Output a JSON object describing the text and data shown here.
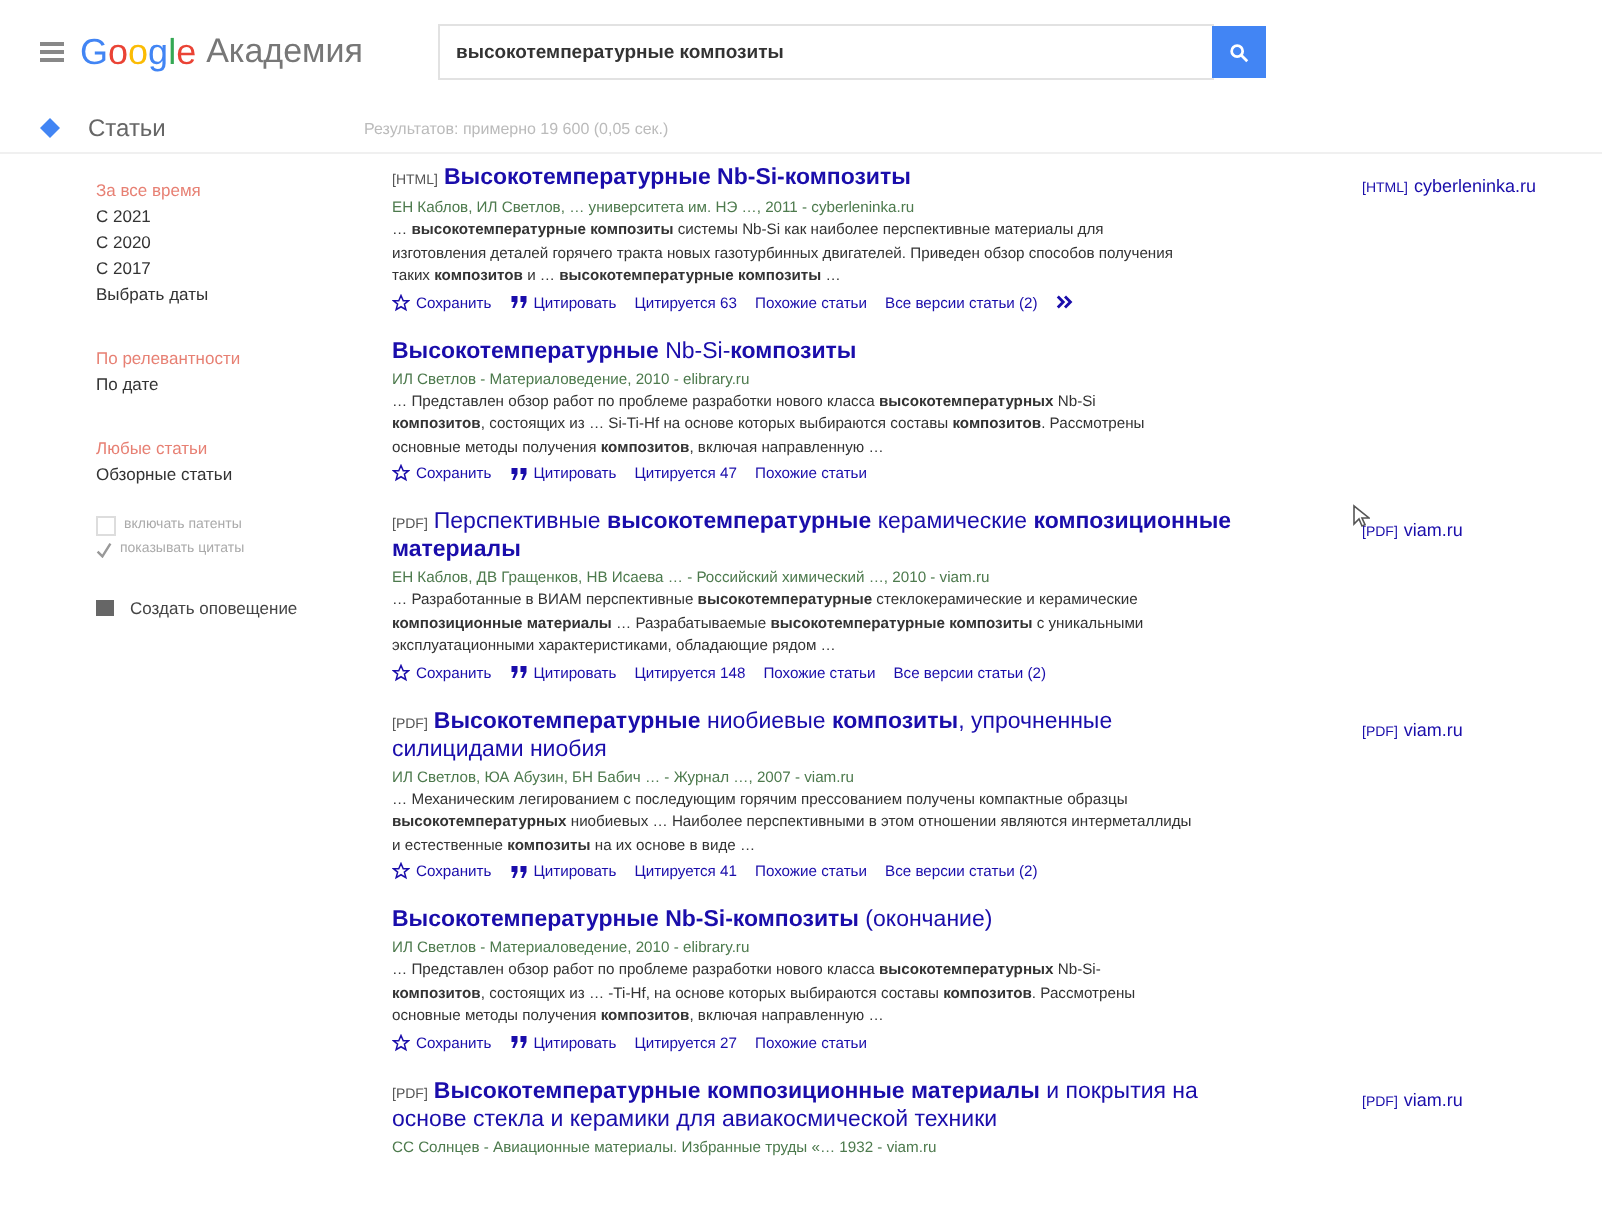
{
  "header": {
    "logo": {
      "brand": "Google",
      "product": "Академия"
    },
    "search": {
      "value": "высокотемпературные композиты"
    }
  },
  "section": {
    "label": "Статьи",
    "stats": "Результатов: примерно 19 600 (0,05 сек.)"
  },
  "sidebar": {
    "groups": [
      {
        "items": [
          {
            "label": "За все время",
            "selected": true
          },
          {
            "label": "С 2021",
            "selected": false
          },
          {
            "label": "С 2020",
            "selected": false
          },
          {
            "label": "С 2017",
            "selected": false
          },
          {
            "label": "Выбрать даты",
            "selected": false
          }
        ]
      },
      {
        "items": [
          {
            "label": "По релевантности",
            "selected": true
          },
          {
            "label": "По дате",
            "selected": false
          }
        ]
      },
      {
        "items": [
          {
            "label": "Любые статьи",
            "selected": true
          },
          {
            "label": "Обзорные статьи",
            "selected": false
          }
        ]
      }
    ],
    "options": [
      {
        "label": "включать патенты",
        "checked": false
      },
      {
        "label": "показывать цитаты",
        "checked": true
      }
    ],
    "alert": "Создать оповещение"
  },
  "results": [
    {
      "tag": "[HTML]",
      "title": "**Высокотемпературные Nb-Si-композиты**",
      "authors": "ЕН Каблов, ИЛ Светлов, … университета им. НЭ …, 2011 - cyberleninka.ru",
      "snippet": "… **высокотемпературные композиты** системы Nb-Si как наиболее перспективные материалы для изготовления деталей горячего тракта новых газотурбинных двигателей. Приведен обзор способов получения таких **композитов** и … **высокотемпературные композиты** …",
      "actions": [
        {
          "kind": "save",
          "label": "Сохранить"
        },
        {
          "kind": "cite",
          "label": "Цитировать"
        },
        {
          "kind": "link",
          "label": "Цитируется 63"
        },
        {
          "kind": "link",
          "label": "Похожие статьи"
        },
        {
          "kind": "link",
          "label": "Все версии статьи (2)"
        },
        {
          "kind": "more"
        }
      ],
      "side": {
        "tag": "[HTML]",
        "source": "cyberleninka.ru"
      }
    },
    {
      "title": "**Высокотемпературные** Nb-Si-**композиты**",
      "authors": "ИЛ Светлов - Материаловедение, 2010 - elibrary.ru",
      "snippet": "… Представлен обзор работ по проблеме разработки нового класса **высокотемпературных** Nb-Si **композитов**, состоящих из … Si-Ti-Hf на основе которых выбираются составы **композитов**. Рассмотрены основные методы получения **композитов**, включая направленную …",
      "actions": [
        {
          "kind": "save",
          "label": "Сохранить"
        },
        {
          "kind": "cite",
          "label": "Цитировать"
        },
        {
          "kind": "link",
          "label": "Цитируется 47"
        },
        {
          "kind": "link",
          "label": "Похожие статьи"
        }
      ]
    },
    {
      "tag": "[PDF]",
      "title": "Перспективные **высокотемпературные** керамические **композиционные материалы**",
      "authors": "ЕН Каблов, ДВ Гращенков, НВ Исаева … - Российский химический …, 2010 - viam.ru",
      "snippet": "… Разработанные в ВИАМ перспективные **высокотемпературные** стеклокерамические и керамические **композиционные материалы** … Разрабатываемые **высокотемпературные композиты** с уникальными эксплуатационными характеристиками, обладающие рядом …",
      "actions": [
        {
          "kind": "save",
          "label": "Сохранить"
        },
        {
          "kind": "cite",
          "label": "Цитировать"
        },
        {
          "kind": "link",
          "label": "Цитируется 148"
        },
        {
          "kind": "link",
          "label": "Похожие статьи"
        },
        {
          "kind": "link",
          "label": "Все версии статьи (2)"
        }
      ],
      "side": {
        "tag": "[PDF]",
        "source": "viam.ru"
      }
    },
    {
      "tag": "[PDF]",
      "title": "**Высокотемпературные** ниобиевые **композиты**, упрочненные силицидами ниобия",
      "authors": "ИЛ Светлов, ЮА Абузин, БН Бабич … - Журнал …, 2007 - viam.ru",
      "snippet": "… Механическим легированием с последующим горячим прессованием получены компактные образцы **высокотемпературных** ниобиевых … Наиболее перспективными в этом отношении являются интерметаллиды и естественные **композиты** на их основе в виде …",
      "actions": [
        {
          "kind": "save",
          "label": "Сохранить"
        },
        {
          "kind": "cite",
          "label": "Цитировать"
        },
        {
          "kind": "link",
          "label": "Цитируется 41"
        },
        {
          "kind": "link",
          "label": "Похожие статьи"
        },
        {
          "kind": "link",
          "label": "Все версии статьи (2)"
        }
      ],
      "side": {
        "tag": "[PDF]",
        "source": "viam.ru"
      }
    },
    {
      "title": "**Высокотемпературные Nb-Si-композиты** (окончание)",
      "authors": "ИЛ Светлов - Материаловедение, 2010 - elibrary.ru",
      "snippet": "… Представлен обзор работ по проблеме разработки нового класса **высокотемпературных** Nb-Si-**композитов**, состоящих из … -Ti-Hf, на основе которых выбираются составы **композитов**. Рассмотрены основные методы получения **композитов**, включая направленную …",
      "actions": [
        {
          "kind": "save",
          "label": "Сохранить"
        },
        {
          "kind": "cite",
          "label": "Цитировать"
        },
        {
          "kind": "link",
          "label": "Цитируется 27"
        },
        {
          "kind": "link",
          "label": "Похожие статьи"
        }
      ]
    },
    {
      "tag": "[PDF]",
      "title": "**Высокотемпературные композиционные материалы** и покрытия на основе стекла и керамики для авиакосмической техники",
      "authors": "СС Солнцев - Авиационные материалы. Избранные труды «… 1932 - viam.ru",
      "side": {
        "tag": "[PDF]",
        "source": "viam.ru"
      }
    }
  ]
}
